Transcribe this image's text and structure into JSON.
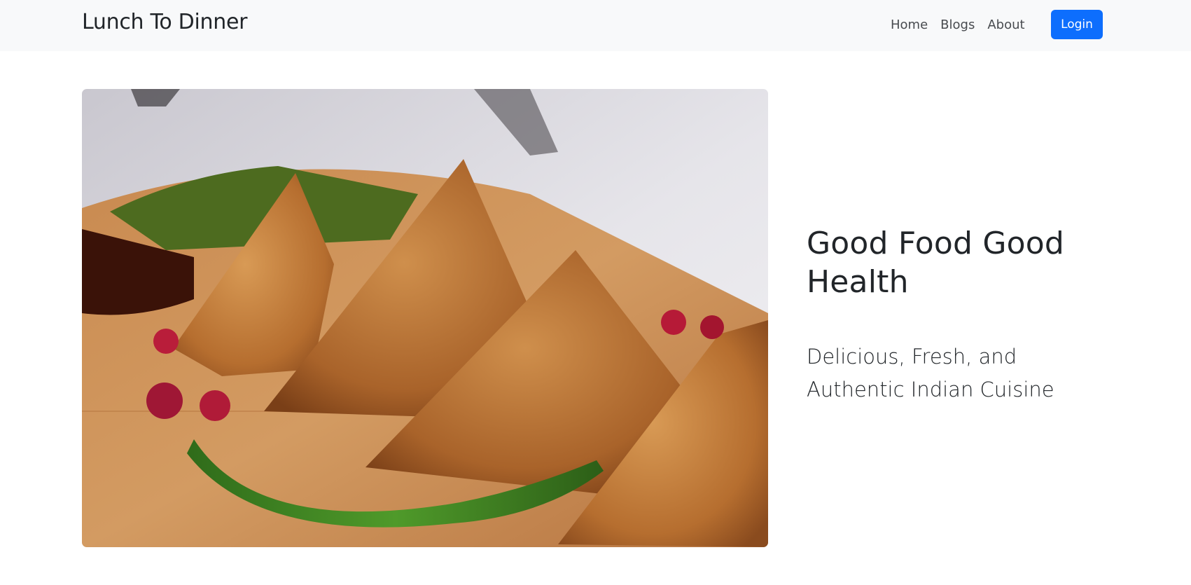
{
  "navbar": {
    "brand": "Lunch To Dinner",
    "links": [
      {
        "label": "Home"
      },
      {
        "label": "Blogs"
      },
      {
        "label": "About"
      }
    ],
    "login_label": "Login"
  },
  "hero": {
    "image_icon": "samosa-plate-photo",
    "title": "Good Food Good Health",
    "subtitle": "Delicious, Fresh, and Authentic Indian Cuisine"
  },
  "colors": {
    "navbar_bg": "#f8f9fa",
    "primary": "#0d6efd",
    "text": "#212529"
  }
}
